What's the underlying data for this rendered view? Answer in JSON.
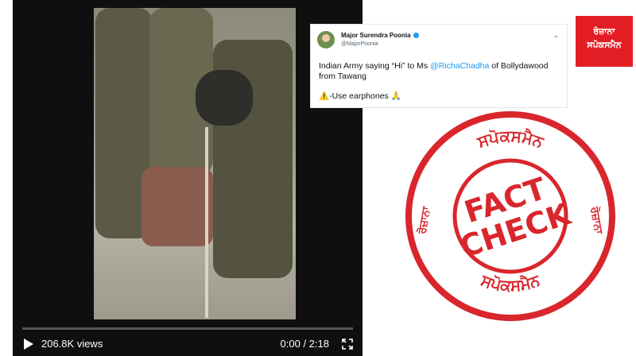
{
  "video": {
    "views": "206.8K views",
    "time": "0:00 / 2:18",
    "progress": 0
  },
  "tweet": {
    "author_name": "Major Surendra Poonia",
    "author_handle": "@MajorPoonia",
    "text_before": "Indian Army saying “Hi” to Ms ",
    "mention": "@RichaChadha",
    "text_after": " of Bollydawood from Tawang",
    "warning_text": "-Use earphones",
    "warning_emoji": "⚠️",
    "pray_emoji": "🙏",
    "verified_color": "#1d9bf0"
  },
  "stamp": {
    "line1": "FACT",
    "line2": "CHECK",
    "top_arc": "ਸਪੋਕਸਮੈਨ",
    "bottom_arc": "ਸਪੋਕਸਮੈਨ",
    "left_arc": "ਰੋਜ਼ਾਨਾ",
    "right_arc": "ਰੋਜ਼ਾਨਾ",
    "color": "#d9262c"
  },
  "logo": {
    "line1": "ਰੋਜ਼ਾਨਾ",
    "line2": "ਸਪੋਕਸਮੈਨ"
  }
}
